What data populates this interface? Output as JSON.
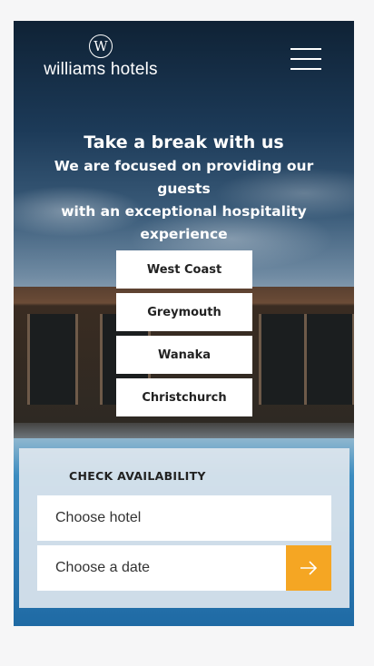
{
  "header": {
    "logo_text": "williams hotels",
    "logo_mark": "W",
    "menu_icon": "hamburger-menu-icon"
  },
  "intro": {
    "title": "Take a break with us",
    "line1": "We are focused on providing our guests",
    "line2": "with an exceptional hospitality",
    "line3": "experience"
  },
  "locations": [
    {
      "label": "West Coast"
    },
    {
      "label": "Greymouth"
    },
    {
      "label": "Wanaka"
    },
    {
      "label": "Christchurch"
    }
  ],
  "availability": {
    "title": "CHECK AVAILABILITY",
    "hotel_placeholder": "Choose hotel",
    "date_placeholder": "Choose a date",
    "submit_icon": "arrow-right-icon",
    "accent_color": "#f5a623"
  }
}
